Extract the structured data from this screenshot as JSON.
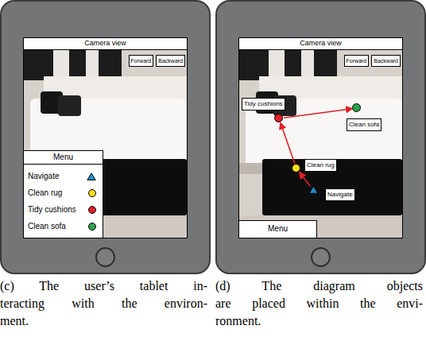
{
  "tablets": [
    {
      "kind": "menu",
      "screen": {
        "title": "Camera view",
        "buttons": [
          "Forward",
          "Backward"
        ],
        "menu": {
          "title": "Menu",
          "expanded": true,
          "items": [
            {
              "label": "Navigate",
              "kind": "triangle",
              "color": "#1e8fd0"
            },
            {
              "label": "Clean rug",
              "kind": "dot",
              "color": "#f5df1b"
            },
            {
              "label": "Tidy cushions",
              "kind": "dot",
              "color": "#e0202a"
            },
            {
              "label": "Clean sofa",
              "kind": "dot",
              "color": "#2ea24a"
            }
          ]
        }
      },
      "caption": [
        "(c) The user’s tablet in-",
        "teracting with the environ-",
        "ment."
      ]
    },
    {
      "kind": "diagram",
      "screen": {
        "title": "Camera view",
        "buttons": [
          "Forward",
          "Backward"
        ],
        "menu": {
          "title": "Menu",
          "expanded": false
        },
        "diagram": {
          "nodes": [
            {
              "label": "Navigate",
              "kind": "triangle",
              "color": "#1e8fd0"
            },
            {
              "label": "Clean rug",
              "kind": "dot",
              "color": "#f5df1b"
            },
            {
              "label": "Tidy cushions",
              "kind": "dot",
              "color": "#e0202a"
            },
            {
              "label": "Clean sofa",
              "kind": "dot",
              "color": "#2ea24a"
            }
          ],
          "edge_color": "#e0202a"
        }
      },
      "caption": [
        "(d) The diagram objects",
        "are placed within the envi-",
        "ronment."
      ]
    }
  ]
}
